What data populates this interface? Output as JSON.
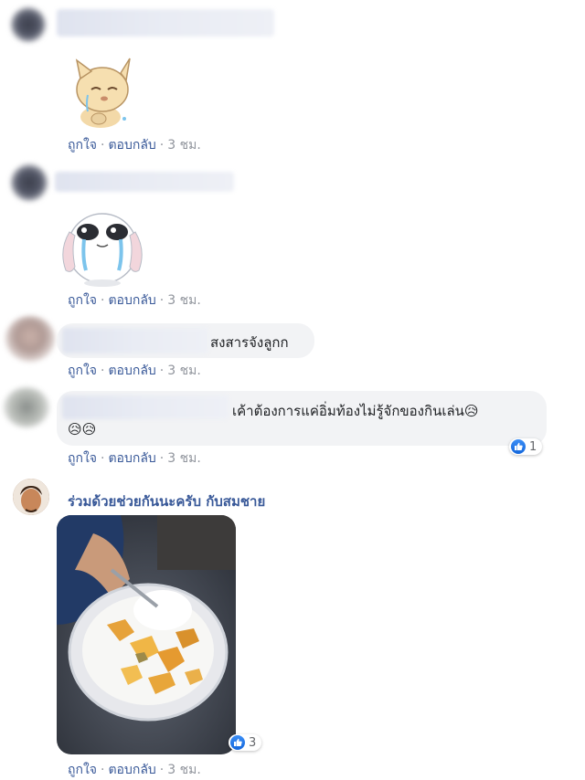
{
  "actions": {
    "like": "ถูกใจ",
    "reply": "ตอบกลับ",
    "separator": "·",
    "time": "3 ชม."
  },
  "comments": [
    {
      "type": "sticker",
      "sticker": "crying-cat-sticker"
    },
    {
      "type": "sticker",
      "sticker": "crying-bunny-sticker"
    },
    {
      "type": "text",
      "text": "สงสารจังลูกก"
    },
    {
      "type": "text",
      "text": "เค้าต้องการแค่อิ่มท้องไม่รู้จักของกินเล่น😥",
      "emoji_line": "😥😥",
      "reactions": {
        "count": "1",
        "icon": "like-icon"
      }
    },
    {
      "type": "photo",
      "author": "ร่วมด้วยช่วยกันนะครับ กับสมชาย",
      "photo": "food-bowl-photo",
      "reactions": {
        "count": "3",
        "icon": "like-icon"
      }
    }
  ],
  "colors": {
    "link": "#385898",
    "muted": "#90949c",
    "bubble": "#f2f3f5",
    "like_blue": "#1877f2"
  }
}
